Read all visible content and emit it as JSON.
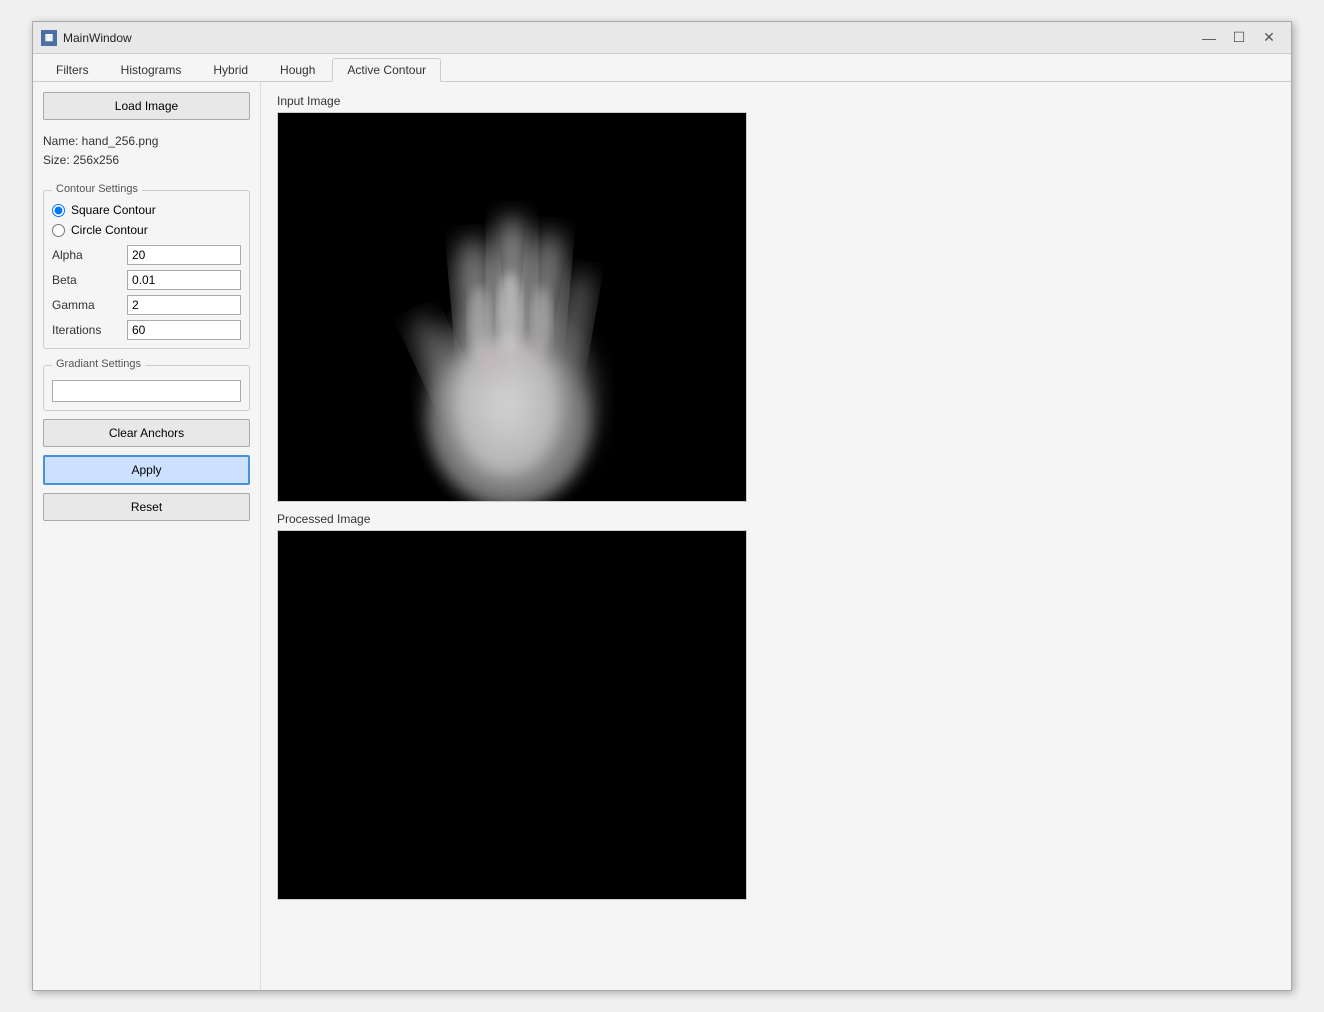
{
  "window": {
    "title": "MainWindow",
    "icon": "M"
  },
  "titlebar": {
    "minimize": "—",
    "maximize": "☐",
    "close": "✕"
  },
  "tabs": [
    {
      "label": "Filters",
      "active": false
    },
    {
      "label": "Histograms",
      "active": false
    },
    {
      "label": "Hybrid",
      "active": false
    },
    {
      "label": "Hough",
      "active": false
    },
    {
      "label": "Active Contour",
      "active": true
    }
  ],
  "sidebar": {
    "load_image_label": "Load Image",
    "file_name_label": "Name: hand_256.png",
    "file_size_label": "Size: 256x256",
    "contour_settings_legend": "Contour Settings",
    "square_contour_label": "Square Contour",
    "circle_contour_label": "Circle Contour",
    "alpha_label": "Alpha",
    "alpha_value": "20",
    "beta_label": "Beta",
    "beta_value": "0.01",
    "gamma_label": "Gamma",
    "gamma_value": "2",
    "iterations_label": "Iterations",
    "iterations_value": "60",
    "gradient_settings_legend": "Gradiant Settings",
    "gradient_value": "",
    "clear_anchors_label": "Clear Anchors",
    "apply_label": "Apply",
    "reset_label": "Reset"
  },
  "main": {
    "input_image_label": "Input Image",
    "processed_image_label": "Processed Image"
  }
}
